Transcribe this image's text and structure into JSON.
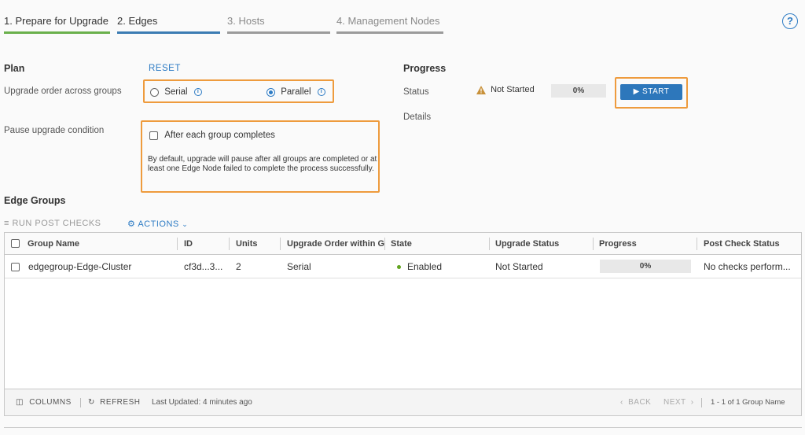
{
  "steps": [
    {
      "label": "1. Prepare for Upgrade"
    },
    {
      "label": "2. Edges"
    },
    {
      "label": "3. Hosts"
    },
    {
      "label": "4. Management Nodes"
    }
  ],
  "help_glyph": "?",
  "plan": {
    "title": "Plan",
    "reset": "RESET",
    "order_label": "Upgrade order across groups",
    "serial": "Serial",
    "parallel": "Parallel",
    "selected_order": "Parallel",
    "info_glyph": "i",
    "pause_label": "Pause upgrade condition",
    "pause_checkbox": "After each group completes",
    "pause_note": "By default, upgrade will pause after all groups are completed or at least one Edge Node failed to complete the process successfully."
  },
  "progress": {
    "title": "Progress",
    "status_label": "Status",
    "status_value": "Not Started",
    "percent": "0%",
    "start_button": "▶ START",
    "details_label": "Details"
  },
  "edge_groups": {
    "title": "Edge Groups",
    "run_post_checks": "RUN POST CHECKS",
    "actions": "ACTIONS",
    "columns": [
      "Group Name",
      "ID",
      "Units",
      "Upgrade Order within G",
      "State",
      "Upgrade Status",
      "Progress",
      "Post Check Status"
    ],
    "rows": [
      {
        "group_name": "edgegroup-Edge-Cluster",
        "id": "cf3d...3...",
        "units": "2",
        "order": "Serial",
        "state": "Enabled",
        "upgrade_status": "Not Started",
        "progress": "0%",
        "post_check": "No checks perform..."
      }
    ],
    "footer": {
      "columns": "COLUMNS",
      "refresh": "REFRESH",
      "last_updated": "Last Updated: 4 minutes ago",
      "back": "BACK",
      "next": "NEXT",
      "count": "1 - 1 of 1 Group Name"
    }
  },
  "colors": {
    "accent": "#2d7bc4",
    "highlight": "#ee9b3d",
    "step_done": "#6ab04c",
    "step_active": "#3b7cb3",
    "enabled_dot": "#62a420",
    "warning": "#c8913a"
  }
}
